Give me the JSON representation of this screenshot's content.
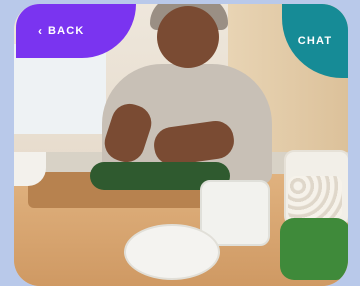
{
  "nav": {
    "back_label": "BACK",
    "back_icon": "chevron-left-icon",
    "chat_label": "CHAT"
  },
  "colors": {
    "back": "#7a34f0",
    "chat": "#168b96",
    "background": "#b9c9ea"
  }
}
